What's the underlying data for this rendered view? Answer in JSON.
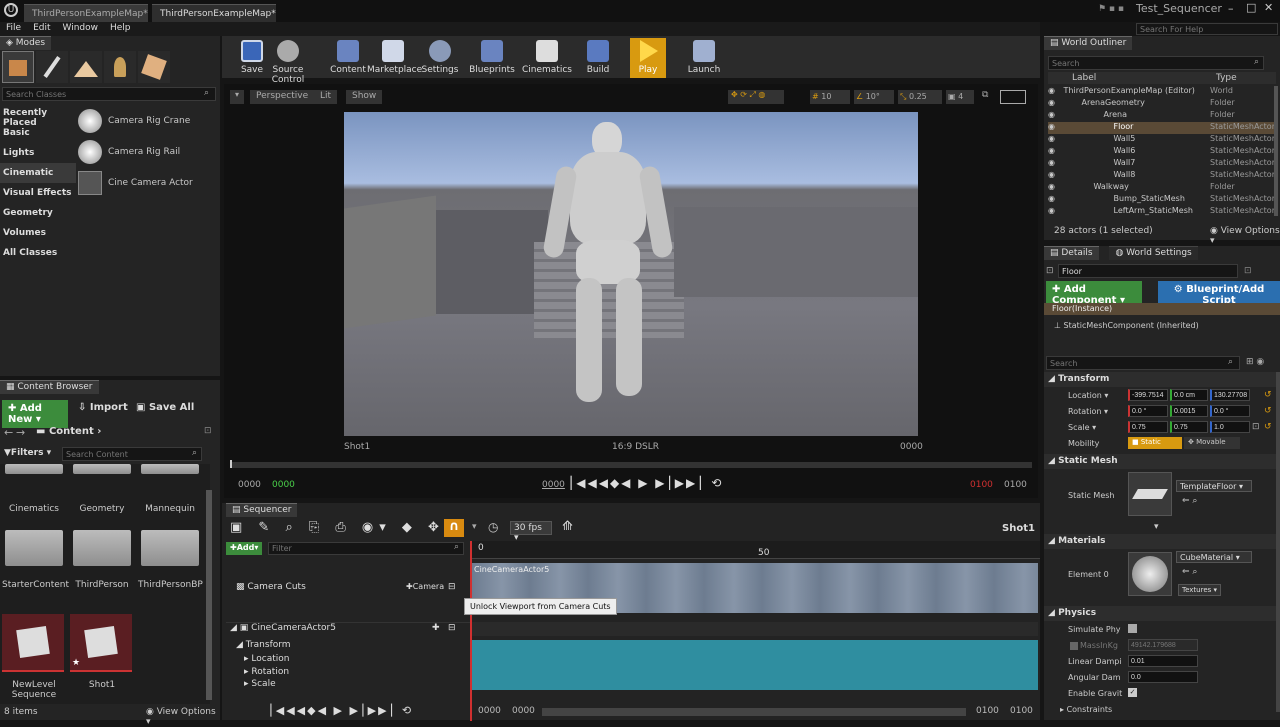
{
  "window": {
    "tabs": [
      "ThirdPersonExampleMap*",
      "ThirdPersonExampleMap*"
    ],
    "project_name": "Test_Sequencer",
    "help_search_placeholder": "Search For Help"
  },
  "menu": [
    "File",
    "Edit",
    "Window",
    "Help"
  ],
  "modes": {
    "tab": "Modes",
    "search_placeholder": "Search Classes",
    "categories": [
      "Recently Placed",
      "Basic",
      "Lights",
      "Cinematic",
      "Visual Effects",
      "Geometry",
      "Volumes",
      "All Classes"
    ],
    "active_category": "Cinematic",
    "items": [
      "Camera Rig Crane",
      "Camera Rig Rail",
      "Cine Camera Actor"
    ]
  },
  "toolbar": [
    "Save",
    "Source Control",
    "Content",
    "Marketplace",
    "Settings",
    "Blueprints",
    "Cinematics",
    "Build",
    "Play",
    "Launch"
  ],
  "viewport": {
    "perspective": "Perspective",
    "lit": "Lit",
    "show": "Show",
    "grid_snap": "10",
    "rotation_snap": "10°",
    "scale_snap": "0.25",
    "camera_speed": "4",
    "shot_label": "Shot1",
    "aspect_label": "16:9 DSLR",
    "frame_label": "0000",
    "transport": {
      "start": "0000",
      "current": "0000",
      "in": "0000",
      "out": "0100",
      "end": "0100"
    }
  },
  "content_browser": {
    "tab": "Content Browser",
    "add_new": "Add New",
    "import": "Import",
    "save_all": "Save All",
    "path": "Content",
    "filters": "Filters",
    "search_placeholder": "Search Content",
    "folders": [
      "Cinematics",
      "Geometry",
      "Mannequin",
      "StarterContent",
      "ThirdPerson",
      "ThirdPersonBP"
    ],
    "assets": [
      "NewLevel Sequence",
      "Shot1"
    ],
    "count": "8 items",
    "view_options": "View Options"
  },
  "sequencer": {
    "tab": "Sequencer",
    "fps": "30 fps",
    "shot_name": "Shot1",
    "add": "Add",
    "filter_placeholder": "Filter",
    "ruler": [
      "0",
      "50"
    ],
    "camera_cuts": "Camera Cuts",
    "camera_button": "Camera",
    "cut_track_label": "CineCameraActor5",
    "tooltip": "Unlock Viewport from Camera Cuts",
    "actor": "CineCameraActor5",
    "tracks": [
      "Transform",
      "Location",
      "Rotation",
      "Scale"
    ],
    "bottom": {
      "a": "0000",
      "b": "0000",
      "c": "0100",
      "d": "0100"
    }
  },
  "world_outliner": {
    "tab": "World Outliner",
    "search_placeholder": "Search",
    "col_label": "Label",
    "col_type": "Type",
    "rows": [
      {
        "label": "ThirdPersonExampleMap (Editor)",
        "type": "World"
      },
      {
        "label": "ArenaGeometry",
        "type": "Folder"
      },
      {
        "label": "Arena",
        "type": "Folder"
      },
      {
        "label": "Floor",
        "type": "StaticMeshActor"
      },
      {
        "label": "Wall5",
        "type": "StaticMeshActor"
      },
      {
        "label": "Wall6",
        "type": "StaticMeshActor"
      },
      {
        "label": "Wall7",
        "type": "StaticMeshActor"
      },
      {
        "label": "Wall8",
        "type": "StaticMeshActor"
      },
      {
        "label": "Walkway",
        "type": "Folder"
      },
      {
        "label": "Bump_StaticMesh",
        "type": "StaticMeshActor"
      },
      {
        "label": "LeftArm_StaticMesh",
        "type": "StaticMeshActor"
      }
    ],
    "actor_count": "28 actors (1 selected)",
    "view_options": "View Options"
  },
  "details": {
    "tab": "Details",
    "tab2": "World Settings",
    "name": "Floor",
    "add_component": "Add Component",
    "blueprint": "Blueprint/Add Script",
    "instance": "Floor(Instance)",
    "component": "StaticMeshComponent (Inherited)",
    "search_placeholder": "Search",
    "transform": "Transform",
    "location_label": "Location",
    "location": [
      "-399.7514",
      "0.0 cm",
      "130.27708"
    ],
    "rotation_label": "Rotation",
    "rotation": [
      "0.0 °",
      "0.0015",
      "0.0 °"
    ],
    "scale_label": "Scale",
    "scale": [
      "0.75",
      "0.75",
      "1.0"
    ],
    "mobility_label": "Mobility",
    "static": "Static",
    "movable": "Movable",
    "static_mesh_section": "Static Mesh",
    "static_mesh_label": "Static Mesh",
    "mesh_name": "TemplateFloor",
    "materials_section": "Materials",
    "element0": "Element 0",
    "material_name": "CubeMaterial",
    "textures": "Textures",
    "physics_section": "Physics",
    "simulate": "Simulate Phy",
    "mass": "MassInKg",
    "mass_value": "49142.179688",
    "linear_damping_label": "Linear Dampi",
    "linear_damping": "0.01",
    "angular_damping_label": "Angular Dam",
    "angular_damping": "0.0",
    "enable_gravity": "Enable Gravit",
    "constraints": "Constraints"
  }
}
